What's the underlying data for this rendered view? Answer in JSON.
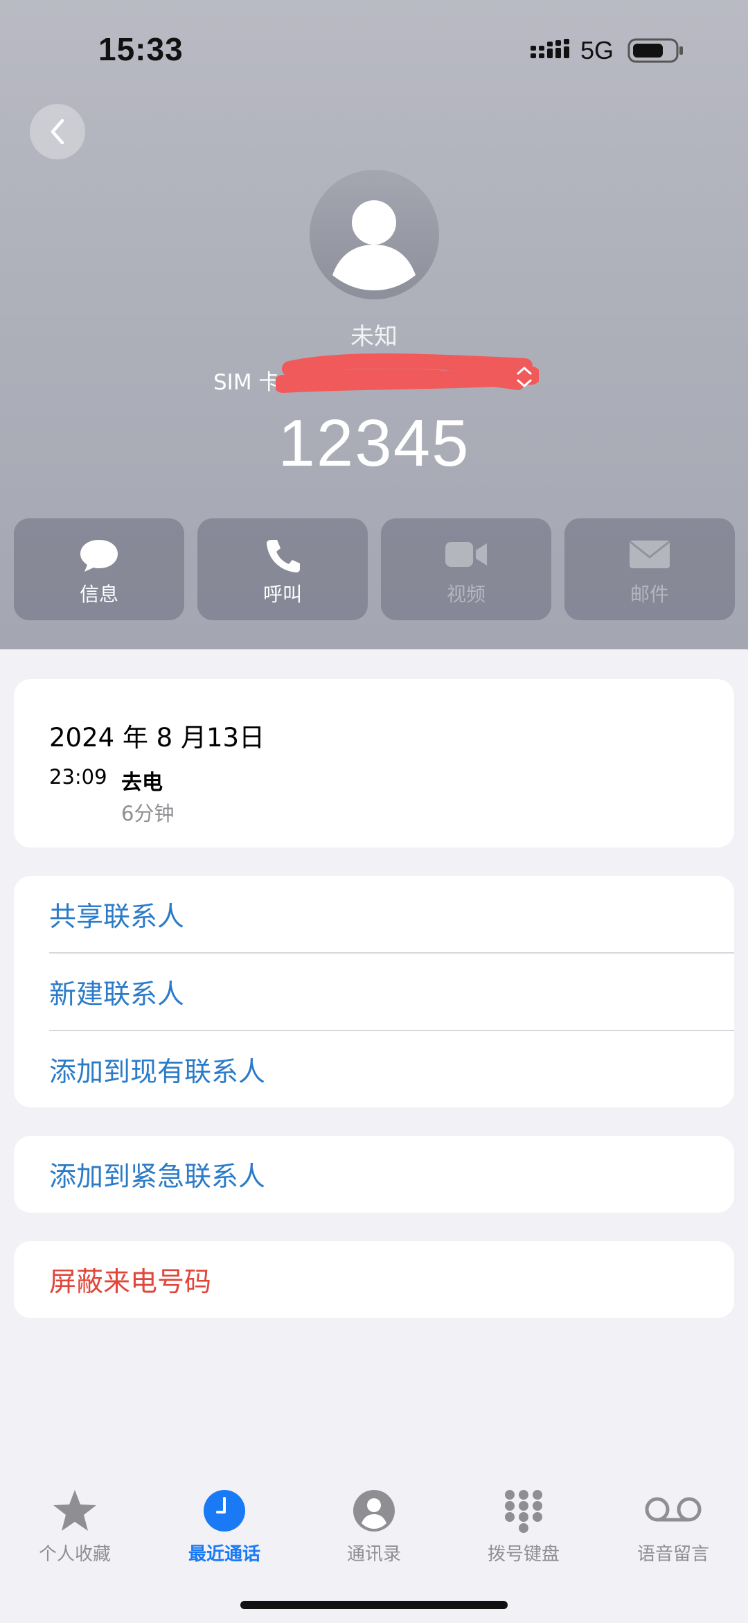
{
  "status_bar": {
    "time": "15:33",
    "network": "5G",
    "icons": [
      "signal-bars-icon",
      "battery-icon"
    ]
  },
  "header": {
    "back_icon": "chevron-left-icon",
    "contact_name": "未知",
    "sim_label": "SIM 卡：",
    "phone_number": "12345"
  },
  "actions": [
    {
      "label": "信息",
      "icon": "message-bubble-icon",
      "enabled": true
    },
    {
      "label": "呼叫",
      "icon": "phone-icon",
      "enabled": true
    },
    {
      "label": "视频",
      "icon": "video-camera-icon",
      "enabled": false
    },
    {
      "label": "邮件",
      "icon": "mail-envelope-icon",
      "enabled": false
    }
  ],
  "call_log": {
    "date": "2024 年 8 月13日",
    "time": "23:09",
    "type": "去电",
    "duration": "6分钟"
  },
  "menu": {
    "share_contact": "共享联系人",
    "new_contact": "新建联系人",
    "add_to_existing": "添加到现有联系人",
    "add_to_emergency": "添加到紧急联系人",
    "block_caller": "屏蔽来电号码"
  },
  "tabs": [
    {
      "label": "个人收藏",
      "icon": "star-icon",
      "active": false
    },
    {
      "label": "最近通话",
      "icon": "clock-icon",
      "active": true
    },
    {
      "label": "通讯录",
      "icon": "person-circle-icon",
      "active": false
    },
    {
      "label": "拨号键盘",
      "icon": "keypad-icon",
      "active": false
    },
    {
      "label": "语音留言",
      "icon": "voicemail-icon",
      "active": false
    }
  ],
  "colors": {
    "link": "#2b7bc8",
    "danger": "#e1463a",
    "active_tab": "#1a7af5",
    "redaction": "#f05a5a"
  }
}
